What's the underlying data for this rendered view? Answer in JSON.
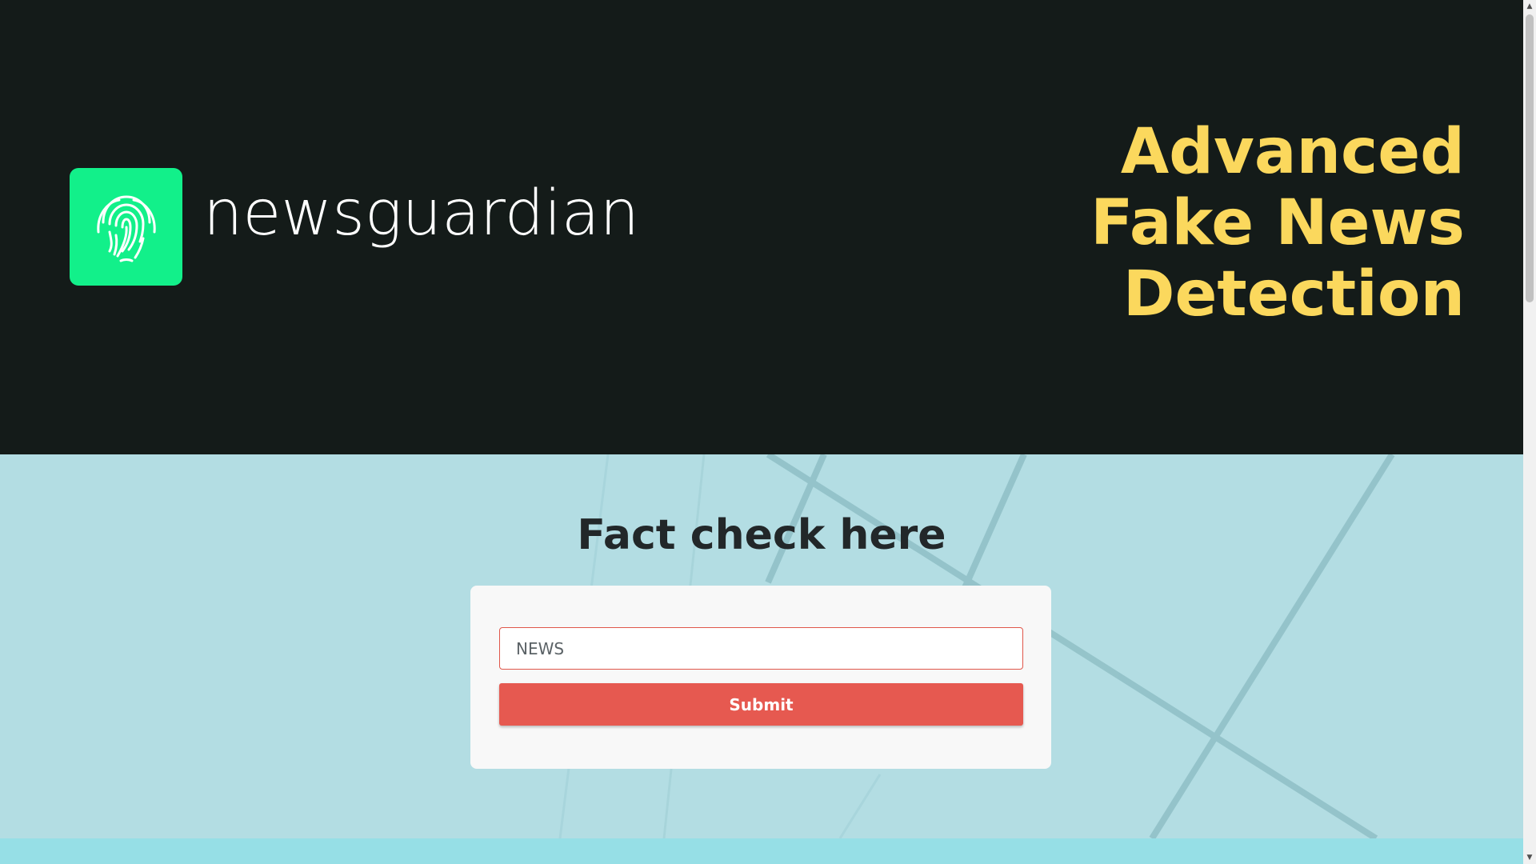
{
  "header": {
    "brand_name": "newsguardian",
    "logo_icon": "fingerprint-icon",
    "title_lines": [
      "Advanced",
      "Fake News",
      "Detection"
    ]
  },
  "fact_check": {
    "heading": "Fact check here",
    "input": {
      "placeholder": "NEWS",
      "value": ""
    },
    "submit_label": "Submit"
  },
  "colors": {
    "header_bg": "#141b19",
    "logo_tile": "#12f08a",
    "title": "#fbd85d",
    "section_bg": "#b3dde3",
    "submit_button": "#e65950",
    "bottom_strip": "#96dfe6"
  },
  "scrollbar": {
    "up_icon": "scroll-up-arrow-icon",
    "down_icon": "scroll-down-arrow-icon"
  }
}
